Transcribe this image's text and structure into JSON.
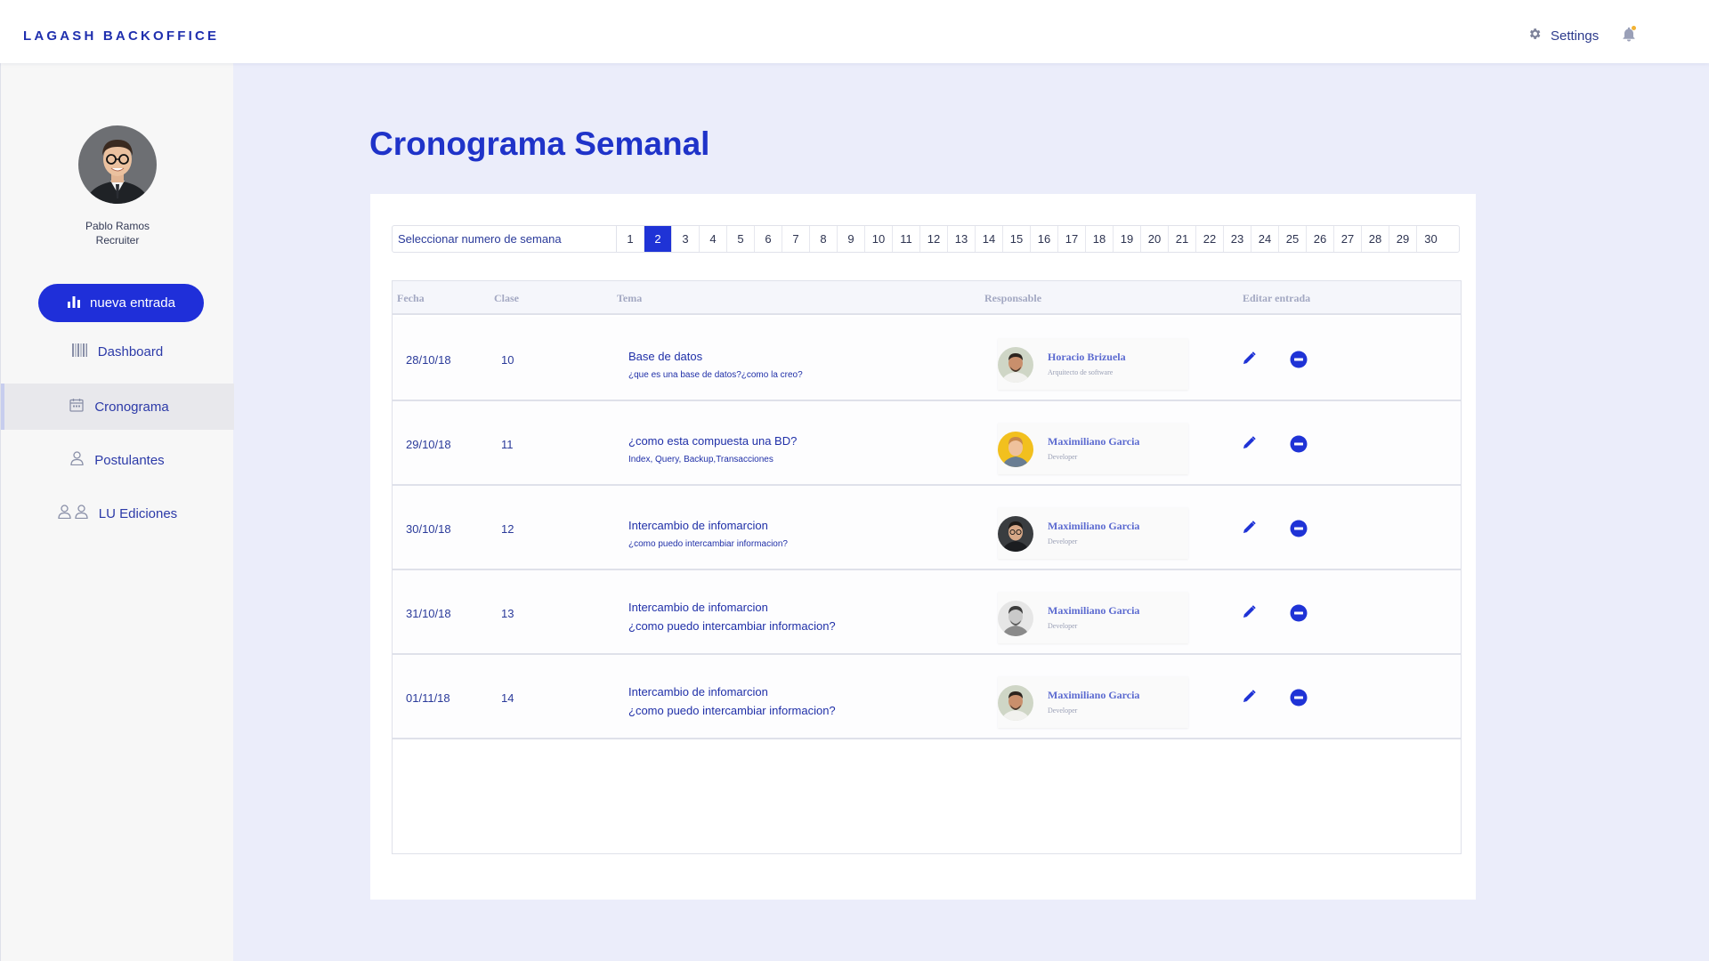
{
  "app": {
    "brand": "LAGASH BACKOFFICE"
  },
  "header": {
    "settings_label": "Settings",
    "icons": [
      "gear-icon",
      "bell-icon"
    ],
    "notification_dot_color": "#f2b233"
  },
  "user": {
    "name": "Pablo Ramos",
    "role": "Recruiter"
  },
  "sidebar": {
    "new_entry_label": "nueva entrada",
    "items": [
      {
        "label": "Dashboard",
        "icon": "barcode-icon",
        "active": false
      },
      {
        "label": "Cronograma",
        "icon": "calendar-icon",
        "active": true
      },
      {
        "label": "Postulantes",
        "icon": "user-icon",
        "active": false
      },
      {
        "label": "LU Ediciones",
        "icon": "users-icon",
        "active": false
      }
    ]
  },
  "main": {
    "title": "Cronograma Semanal",
    "week_selector": {
      "label": "Seleccionar  numero de semana",
      "weeks": [
        "1",
        "2",
        "3",
        "4",
        "5",
        "6",
        "7",
        "8",
        "9",
        "10",
        "11",
        "12",
        "13",
        "14",
        "15",
        "16",
        "17",
        "18",
        "19",
        "20",
        "21",
        "22",
        "23",
        "24",
        "25",
        "26",
        "27",
        "28",
        "29",
        "30"
      ],
      "selected": "2"
    },
    "table": {
      "columns": [
        "Fecha",
        "Clase",
        "Tema",
        "Responsable",
        "Editar entrada"
      ],
      "rows": [
        {
          "fecha": "28/10/18",
          "clase": "10",
          "tema": "Base de datos",
          "subtema": "¿que es una base de datos?¿como la creo?",
          "responsable": "Horacio Brizuela",
          "rol": "Arquitecto de software"
        },
        {
          "fecha": "29/10/18",
          "clase": "11",
          "tema": "¿como esta compuesta una BD?",
          "subtema": "Index, Query, Backup,Transacciones",
          "responsable": "Maximiliano Garcia",
          "rol": "Developer"
        },
        {
          "fecha": "30/10/18",
          "clase": "12",
          "tema": "Intercambio de infomarcion",
          "subtema": "¿como puedo intercambiar informacion?",
          "responsable": "Maximiliano Garcia",
          "rol": "Developer"
        },
        {
          "fecha": "31/10/18",
          "clase": "13",
          "tema": "Intercambio de infomarcion",
          "subtema": "¿como puedo intercambiar informacion?",
          "responsable": "Maximiliano Garcia",
          "rol": "Developer"
        },
        {
          "fecha": "01/11/18",
          "clase": "14",
          "tema": "Intercambio de infomarcion",
          "subtema": "¿como puedo intercambiar informacion?",
          "responsable": "Maximiliano Garcia",
          "rol": "Developer"
        }
      ],
      "actions": [
        "pencil-icon",
        "minus-circle-icon"
      ]
    }
  },
  "colors": {
    "accent": "#1f33d6",
    "background": "#ebedfa",
    "sidebar": "#f7f7f7"
  }
}
